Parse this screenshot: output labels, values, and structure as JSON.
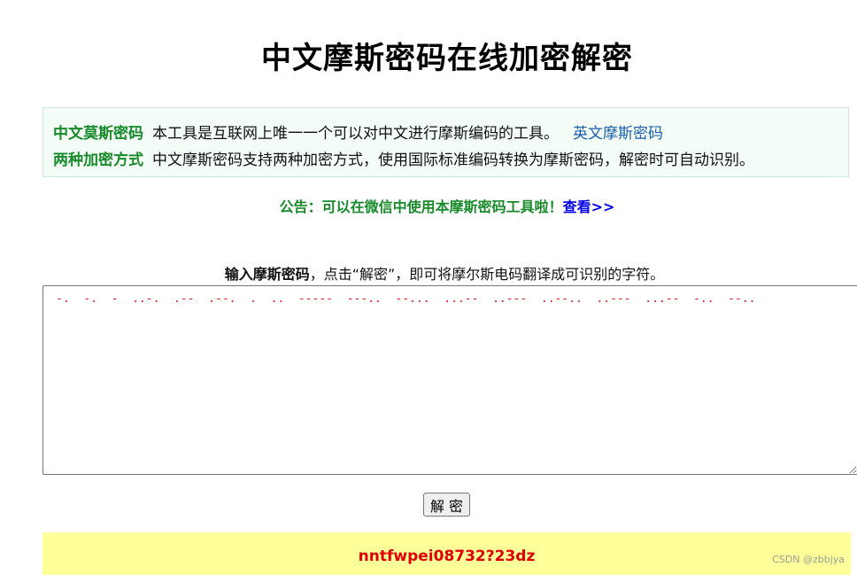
{
  "header": {
    "title": "中文摩斯密码在线加密解密"
  },
  "info": {
    "row1": {
      "label": "中文莫斯密码",
      "text": "本工具是互联网上唯一一个可以对中文进行摩斯编码的工具。",
      "link": "英文摩斯密码"
    },
    "row2": {
      "label": "两种加密方式",
      "text": "中文摩斯密码支持两种加密方式，使用国际标准编码转换为摩斯密码，解密时可自动识别。"
    }
  },
  "notice": {
    "text": "公告：可以在微信中使用本摩斯密码工具啦！",
    "link": "查看>>"
  },
  "instruction": {
    "bold": "输入摩斯密码",
    "rest": "，点击“解密”，即可将摩尔斯电码翻译成可识别的字符。"
  },
  "input": {
    "value": "-.  -.  -  ..-.  .--  .--.  .  ..  -----  ---..  --...  ...--  ..---  ..--..  ..---  ...--  -..  --.."
  },
  "decode_button": {
    "label": "解 密"
  },
  "result": {
    "text": "nntfwpei08732?23dz"
  },
  "watermark": {
    "text": "CSDN @zbbjya"
  },
  "colors": {
    "label_green": "#178a2a",
    "link_blue": "#0000ee",
    "morse_red": "#e02020",
    "result_red": "#e00000",
    "result_bg": "#ffff99"
  }
}
